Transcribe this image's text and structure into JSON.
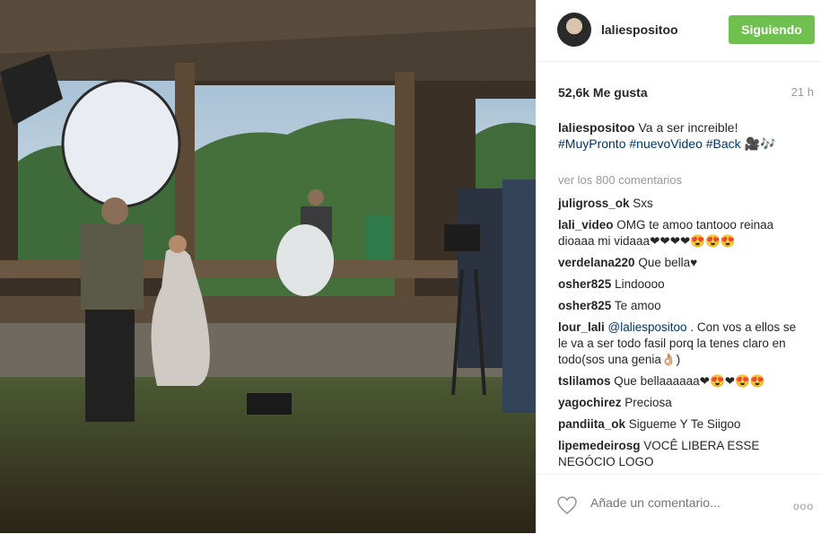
{
  "post": {
    "username": "laliespositoo",
    "follow_label": "Siguiendo",
    "likes": "52,6k Me gusta",
    "time": "21 h",
    "caption_text": "Va a ser increible!",
    "caption_tags": [
      "#MuyPronto",
      "#nuevoVideo",
      "#Back"
    ],
    "caption_tail": "🎥🎶",
    "view_more": "ver los 800 comentarios"
  },
  "comments": [
    {
      "user": "juligross_ok",
      "text": "Sxs"
    },
    {
      "user": "lali_video",
      "text": "OMG te amoo tantooo reinaa dioaaa mi vidaaa❤❤❤❤😍😍😍"
    },
    {
      "user": "verdelana220",
      "text": "Que bella♥"
    },
    {
      "user": "osher825",
      "text": "Lindoooo"
    },
    {
      "user": "osher825",
      "text": "Te amoo"
    },
    {
      "user": "lour_lali",
      "mention": "@laliespositoo",
      "text": ". Con vos a ellos se le va a ser todo fasil porq la tenes claro en todo(sos una genia👌🏼)"
    },
    {
      "user": "tslilamos",
      "text": "Que bellaaaaaa❤😍❤😍😍"
    },
    {
      "user": "yagochirez",
      "text": "Preciosa"
    },
    {
      "user": "pandiita_ok",
      "text": "Sigueme Y Te Siigoo"
    },
    {
      "user": "lipemedeirosg",
      "text": "VOCÊ LIBERA ESSE NEGÓCIO LOGO"
    }
  ],
  "add_comment_placeholder": "Añade un comentario...",
  "more_options": "ooo",
  "colors": {
    "follow_bg": "#70c050",
    "link": "#003569",
    "muted": "#999999"
  }
}
